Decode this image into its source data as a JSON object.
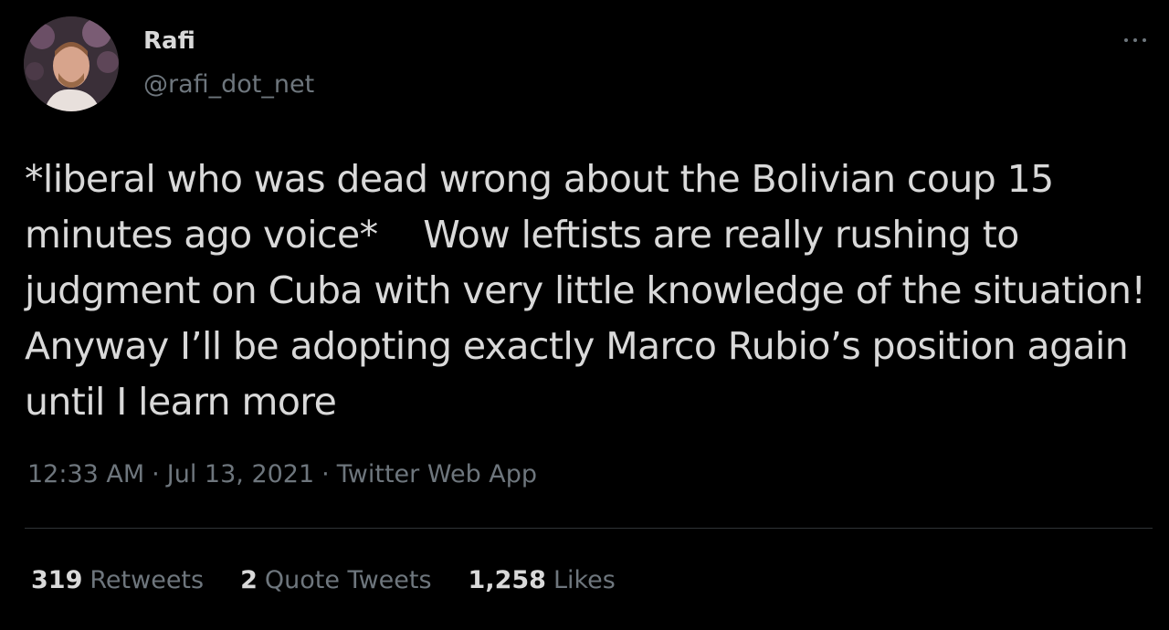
{
  "author": {
    "name": "Rafi",
    "handle": "@rafi_dot_net",
    "avatar_icon": "profile-photo"
  },
  "tweet": {
    "text": "*liberal who was dead wrong about the Bolivian coup 15 minutes ago voice*    Wow leftists are really rushing to judgment on Cuba with very little knowledge of the situation! Anyway I’ll be adopting exactly Marco Rubio’s position again until I learn more"
  },
  "meta": {
    "time": "12:33 AM",
    "date": "Jul 13, 2021",
    "separator": "·",
    "source": "Twitter Web App"
  },
  "stats": {
    "retweets_count": "319",
    "retweets_label": "Retweets",
    "quotes_count": "2",
    "quotes_label": "Quote Tweets",
    "likes_count": "1,258",
    "likes_label": "Likes"
  },
  "icons": {
    "more": "more-options-icon"
  },
  "colors": {
    "background": "#000000",
    "primary_text": "#d9d9d9",
    "secondary_text": "#6e767d",
    "divider": "#2f3336"
  }
}
